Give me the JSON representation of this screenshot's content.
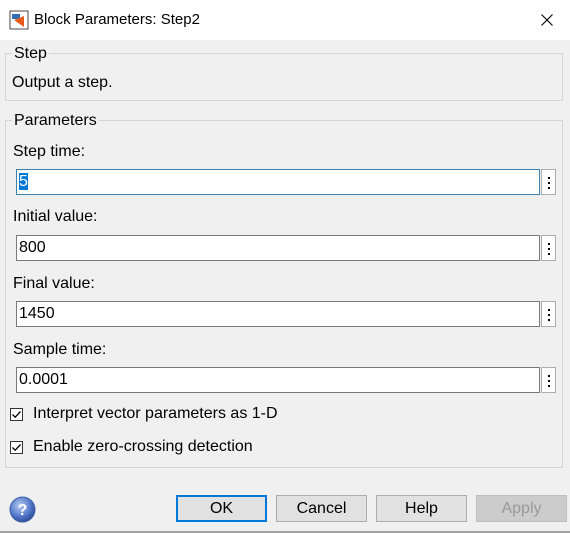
{
  "window": {
    "title": "Block Parameters: Step2",
    "close_icon": "close-icon",
    "app_icon": "simulink-block-icon"
  },
  "block_group": {
    "legend": "Step",
    "description": "Output a step."
  },
  "parameters_group": {
    "legend": "Parameters",
    "fields": [
      {
        "label": "Step time:",
        "value": "5"
      },
      {
        "label": "Initial value:",
        "value": "800"
      },
      {
        "label": "Final value:",
        "value": "1450"
      },
      {
        "label": "Sample time:",
        "value": "0.0001"
      }
    ],
    "checkboxes": [
      {
        "label": "Interpret vector parameters as 1-D",
        "checked": true
      },
      {
        "label": "Enable zero-crossing detection",
        "checked": true
      }
    ]
  },
  "buttons": {
    "ok": "OK",
    "cancel": "Cancel",
    "help": "Help",
    "apply": "Apply"
  },
  "colors": {
    "accent": "#0078d7",
    "background": "#f0f0f0"
  }
}
